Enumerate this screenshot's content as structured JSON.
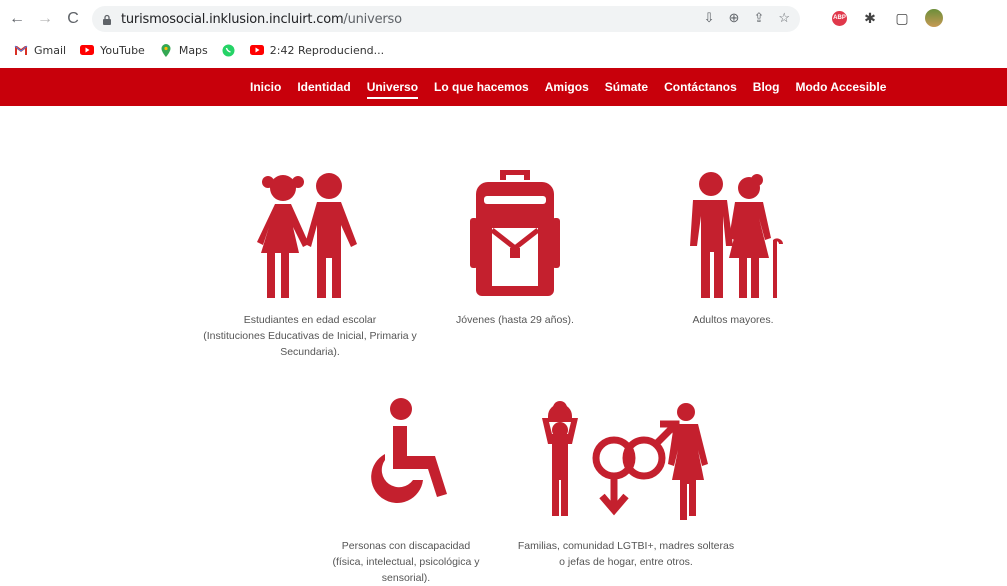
{
  "browser": {
    "url_host": "turismosocial.inklusion.incluirt.com",
    "url_path": "/universo"
  },
  "bookmarks": [
    {
      "label": "Gmail",
      "icon": "gmail-icon"
    },
    {
      "label": "YouTube",
      "icon": "youtube-icon"
    },
    {
      "label": "Maps",
      "icon": "maps-icon"
    },
    {
      "label": "",
      "icon": "whatsapp-icon"
    },
    {
      "label": "2:42 Reproduciend...",
      "icon": "youtube-icon"
    }
  ],
  "nav": {
    "items": [
      "Inicio",
      "Identidad",
      "Universo",
      "Lo que hacemos",
      "Amigos",
      "Súmate",
      "Contáctanos",
      "Blog",
      "Modo Accesible"
    ],
    "active": "Universo"
  },
  "colors": {
    "brand": "#c8000b",
    "icon": "#c4202e"
  },
  "cards": [
    {
      "icon": "children-icon",
      "lines": [
        "Estudiantes en edad escolar",
        "(Instituciones Educativas de Inicial, Primaria y",
        "Secundaria)."
      ]
    },
    {
      "icon": "backpack-icon",
      "lines": [
        "Jóvenes (hasta 29 años)."
      ]
    },
    {
      "icon": "elderly-couple-icon",
      "lines": [
        "Adultos mayores."
      ]
    },
    {
      "icon": "wheelchair-icon",
      "lines": [
        "Personas con discapacidad",
        "(física, intelectual, psicológica y sensorial)."
      ]
    },
    {
      "icon": "family-diversity-icon",
      "lines": [
        "Familias, comunidad LGTBI+, madres solteras",
        "o jefas de hogar, entre otros."
      ]
    }
  ]
}
